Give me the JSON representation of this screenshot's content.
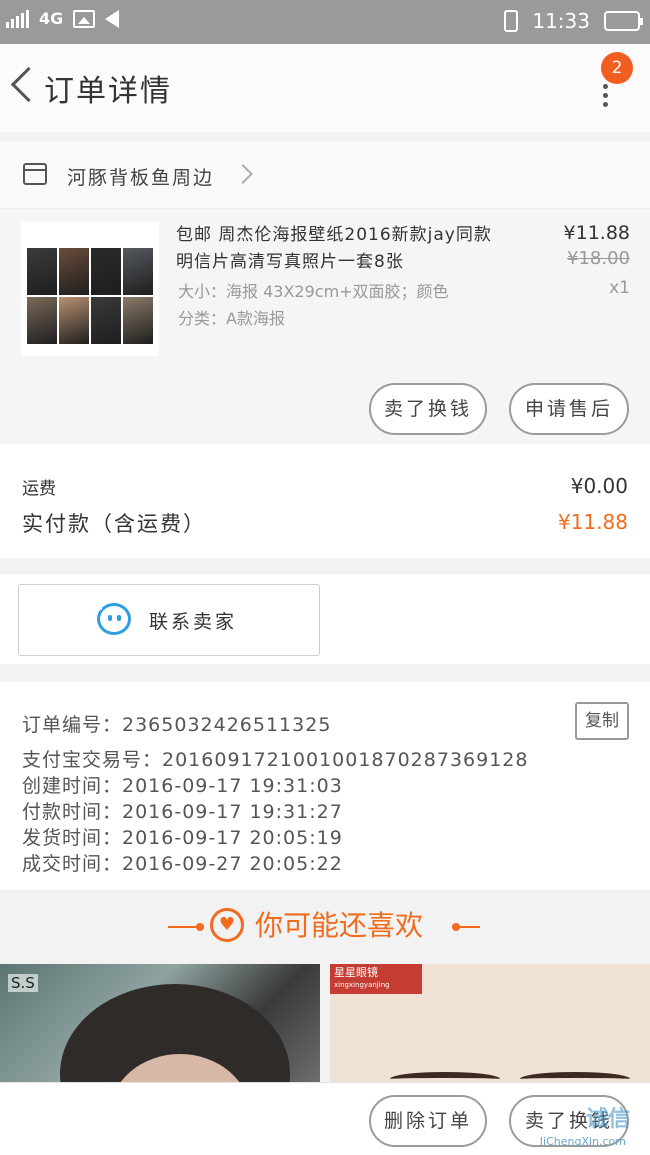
{
  "status_bar": {
    "network": "4G",
    "time": "11:33"
  },
  "nav": {
    "title": "订单详情",
    "badge_count": "2"
  },
  "shop": {
    "name": "河豚背板鱼周边"
  },
  "product": {
    "title": "包邮 周杰伦海报壁纸2016新款jay同款明信片高清写真照片一套8张",
    "spec_size": "大小：海报 43X29cm+双面胶；颜色",
    "spec_class": "分类：A款海报",
    "price": "¥11.88",
    "original_price": "¥18.00",
    "quantity": "x1",
    "thumb_colors": [
      "#3b3b3b",
      "#6b4c3a",
      "#2a2a2a",
      "#555a60",
      "#7a6a5a",
      "#b89070",
      "#3a3a3a",
      "#8a7a6a"
    ],
    "btn_exchange": "卖了换钱",
    "btn_aftersale": "申请售后"
  },
  "summary": {
    "shipping_label": "运费",
    "shipping_value": "¥0.00",
    "paid_label": "实付款（含运费）",
    "paid_value": "¥11.88"
  },
  "contact": {
    "label": "联系卖家"
  },
  "order_info": {
    "order_no": "订单编号：2365032426511325",
    "alipay_no": "支付宝交易号：2016091721001001870287369128",
    "created": "创建时间：2016-09-17 19:31:03",
    "paid": "付款时间：2016-09-17 19:31:27",
    "shipped": "发货时间：2016-09-17 20:05:19",
    "done": "成交时间：2016-09-27 20:05:22",
    "copy_label": "复制"
  },
  "recommend": {
    "title": "你可能还喜欢",
    "item1_watermark": "S.S",
    "item2_tag": "星星眼镜",
    "item2_tag_sub": "xingxingyanjing"
  },
  "bottom": {
    "delete_label": "删除订单",
    "exchange_label": "卖了换钱",
    "watermark": "诚信",
    "watermark_sub": "JiChengXin.com"
  },
  "colors": {
    "accent": "#f26b1d",
    "badge": "#f25d22",
    "chat_blue": "#2d9ee0"
  }
}
